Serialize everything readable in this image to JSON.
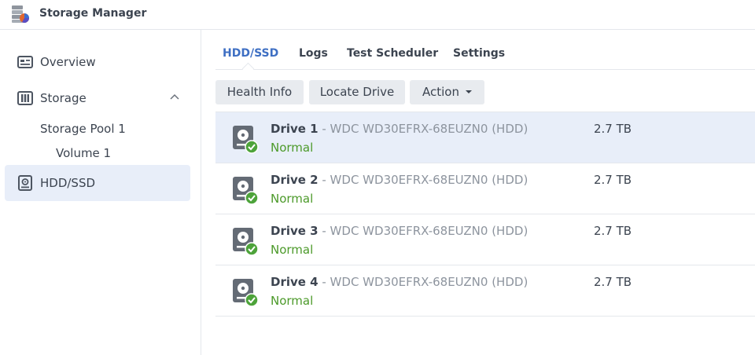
{
  "app": {
    "title": "Storage Manager",
    "icon": "storage-manager-icon"
  },
  "sidebar": {
    "items": [
      {
        "label": "Overview",
        "icon": "overview-icon"
      },
      {
        "label": "Storage",
        "icon": "storage-icon",
        "expanded": true
      },
      {
        "label": "HDD/SSD",
        "icon": "hdd-icon",
        "active": true
      }
    ],
    "sub_items": [
      {
        "label": "Storage Pool 1"
      },
      {
        "label": "Volume 1"
      }
    ]
  },
  "tabs": [
    {
      "label": "HDD/SSD",
      "active": true
    },
    {
      "label": "Logs"
    },
    {
      "label": "Test Scheduler"
    },
    {
      "label": "Settings"
    }
  ],
  "toolbar": {
    "health_info": "Health Info",
    "locate_drive": "Locate Drive",
    "action": "Action"
  },
  "drives": [
    {
      "name": "Drive 1",
      "model": " - WDC WD30EFRX-68EUZN0 (HDD)",
      "status": "Normal",
      "size": "2.7 TB",
      "selected": true
    },
    {
      "name": "Drive 2",
      "model": " - WDC WD30EFRX-68EUZN0 (HDD)",
      "status": "Normal",
      "size": "2.7 TB"
    },
    {
      "name": "Drive 3",
      "model": " - WDC WD30EFRX-68EUZN0 (HDD)",
      "status": "Normal",
      "size": "2.7 TB"
    },
    {
      "name": "Drive 4",
      "model": " - WDC WD30EFRX-68EUZN0 (HDD)",
      "status": "Normal",
      "size": "2.7 TB"
    }
  ],
  "colors": {
    "accent": "#3e6fc3",
    "status_ok": "#4c9a2a",
    "selected_bg": "#e8eef9"
  }
}
